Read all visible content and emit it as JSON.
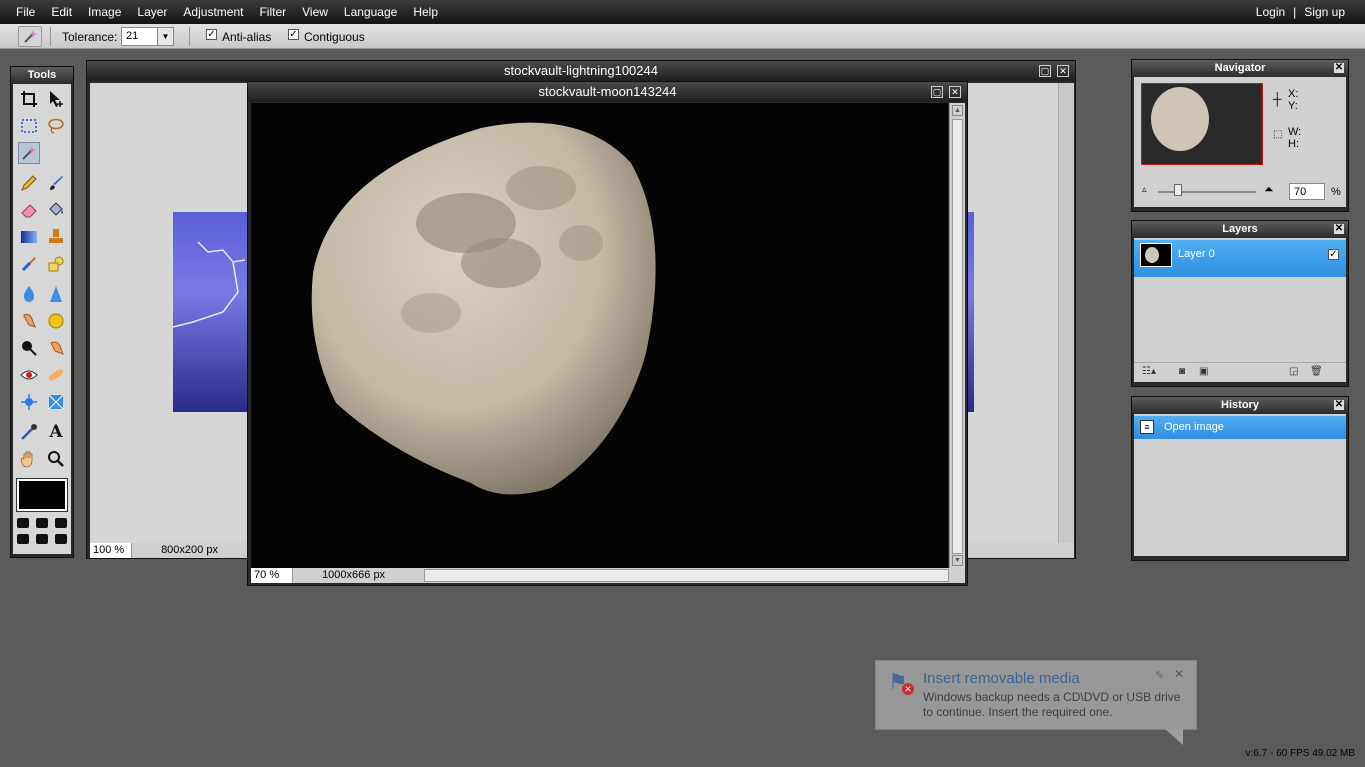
{
  "menubar": {
    "items": [
      "File",
      "Edit",
      "Image",
      "Layer",
      "Adjustment",
      "Filter",
      "View",
      "Language",
      "Help"
    ],
    "login": "Login",
    "separator": "|",
    "signup": "Sign up"
  },
  "options": {
    "tolerance_label": "Tolerance:",
    "tolerance_value": "21",
    "antialias_label": "Anti-alias",
    "antialias_checked": true,
    "contiguous_label": "Contiguous",
    "contiguous_checked": true
  },
  "tools": {
    "title": "Tools",
    "icons": [
      "crop-icon",
      "move-icon",
      "marquee-icon",
      "lasso-icon",
      "magic-wand-icon",
      "pencil-icon",
      "brush-icon",
      "eraser-icon",
      "paint-bucket-icon",
      "gradient-icon",
      "stamp-icon",
      "color-replace-icon",
      "shape-icon",
      "blur-icon",
      "sharpen-icon",
      "smudge-icon",
      "sponge-icon",
      "dodge-icon",
      "burn-icon",
      "red-eye-icon",
      "spot-heal-icon",
      "bloat-icon",
      "pinch-icon",
      "color-picker-icon",
      "text-icon",
      "hand-icon",
      "zoom-icon"
    ]
  },
  "window1": {
    "title": "stockvault-lightning100244",
    "zoom": "100",
    "zoom_unit": "%",
    "size": "800x200 px"
  },
  "window2": {
    "title": "stockvault-moon143244",
    "zoom": "70",
    "zoom_unit": "%",
    "size": "1000x666 px"
  },
  "navigator": {
    "title": "Navigator",
    "x_label": "X:",
    "y_label": "Y:",
    "w_label": "W:",
    "h_label": "H:",
    "zoom": "70",
    "zoom_unit": "%"
  },
  "layers": {
    "title": "Layers",
    "items": [
      {
        "name": "Layer 0",
        "visible": true
      }
    ]
  },
  "history": {
    "title": "History",
    "items": [
      "Open image"
    ]
  },
  "notification": {
    "title": "Insert removable media",
    "body": "Windows backup needs a CD\\DVD or USB drive to continue. Insert the required one."
  },
  "footer": {
    "version": "v:6.7 - 60 FPS 49.02 MB"
  },
  "colors": {
    "accent": "#3d9be9",
    "foreground_swatch": "#000000"
  }
}
